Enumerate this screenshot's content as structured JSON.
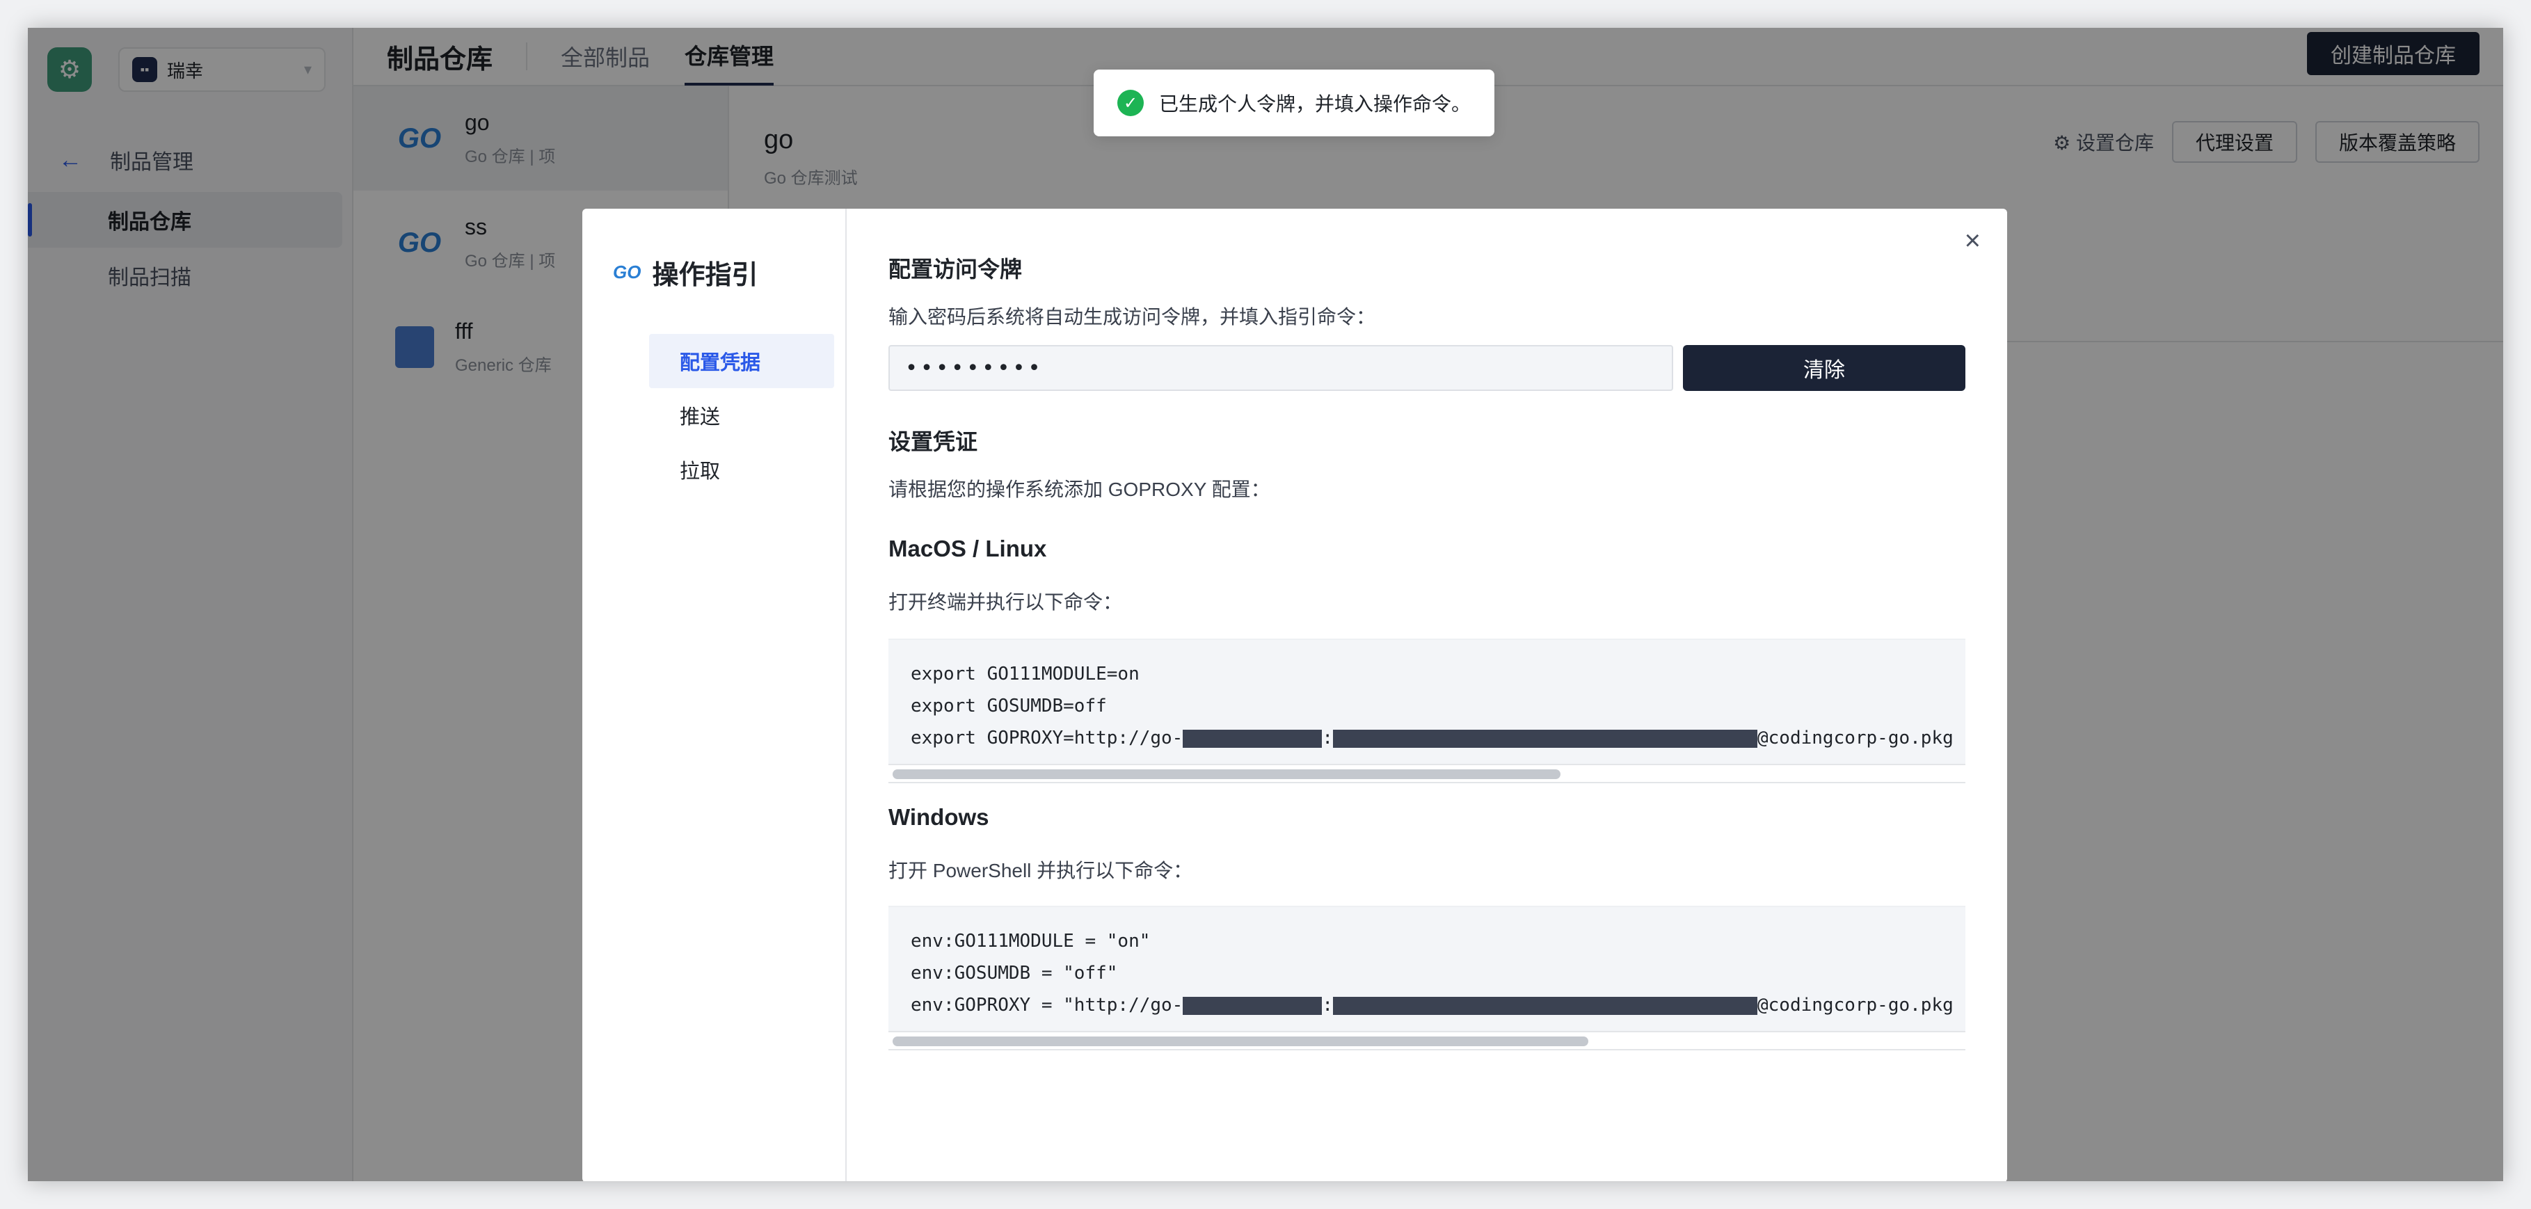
{
  "app": {
    "team_name": "瑞幸",
    "back_label": "制品管理",
    "sidebar_items": [
      {
        "label": "制品仓库",
        "active": true
      },
      {
        "label": "制品扫描",
        "active": false
      }
    ]
  },
  "topbar": {
    "title": "制品仓库",
    "tabs": [
      {
        "label": "全部制品",
        "active": false
      },
      {
        "label": "仓库管理",
        "active": true
      }
    ],
    "create_button": "创建制品仓库"
  },
  "repos": [
    {
      "name": "go",
      "desc": "Go 仓库 | 项",
      "icon": "go-icon",
      "active": true
    },
    {
      "name": "ss",
      "desc": "Go 仓库 | 项",
      "icon": "go-icon",
      "active": false
    },
    {
      "name": "fff",
      "desc": "Generic 仓库",
      "icon": "generic-icon",
      "active": false
    }
  ],
  "detail": {
    "title": "go",
    "subtitle": "Go 仓库测试",
    "settings_link": "设置仓库",
    "proxy_button": "代理设置",
    "override_button": "版本覆盖策略"
  },
  "toast": {
    "message": "已生成个人令牌，并填入操作命令。"
  },
  "modal": {
    "title": "操作指引",
    "nav": [
      {
        "label": "配置凭据",
        "active": true
      },
      {
        "label": "推送",
        "active": false
      },
      {
        "label": "拉取",
        "active": false
      }
    ],
    "token_section": {
      "heading": "配置访问令牌",
      "desc": "输入密码后系统将自动生成访问令牌，并填入指引命令：",
      "input_value": "•••••••••",
      "clear_button": "清除"
    },
    "credential_section": {
      "heading": "设置凭证",
      "desc": "请根据您的操作系统添加 GOPROXY 配置："
    },
    "macos": {
      "heading": "MacOS / Linux",
      "desc": "打开终端并执行以下命令：",
      "line1": "export GO111MODULE=on",
      "line2": "export GOSUMDB=off",
      "line3_prefix": "export GOPROXY=http://go-",
      "line3_suffix": "@codingcorp-go.pkg"
    },
    "windows": {
      "heading": "Windows",
      "desc": "打开 PowerShell 并执行以下命令：",
      "line1": "env:GO111MODULE = \"on\"",
      "line2": "env:GOSUMDB = \"off\"",
      "line3_prefix": "env:GOPROXY = \"http://go-",
      "line3_suffix": "@codingcorp-go.pkg"
    }
  },
  "colors": {
    "accent": "#2a59e8",
    "primary_dark": "#1b2336",
    "success": "#1db454"
  }
}
